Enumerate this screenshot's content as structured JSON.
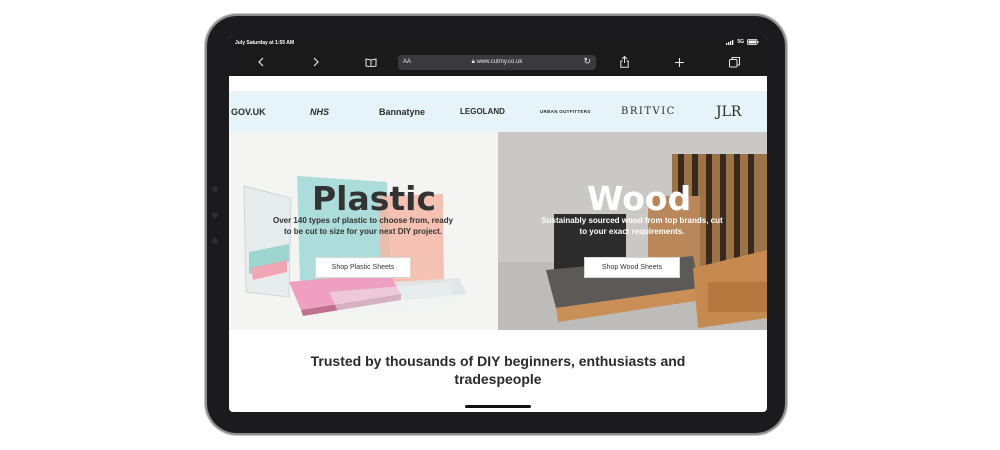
{
  "status_bar": {
    "time": "July Saturday at 1:55 AM",
    "network": "5G",
    "icons": [
      "signal-icon",
      "battery-icon"
    ]
  },
  "browser": {
    "text_size_label": "AA",
    "url": "www.cutmy.co.uk",
    "toolbar_icons": [
      "back-icon",
      "forward-icon",
      "bookmarks-icon",
      "lock-icon",
      "reload-icon",
      "share-icon",
      "new-tab-icon",
      "tabs-icon"
    ]
  },
  "logos": [
    {
      "name": "gov-uk",
      "text": "GOV.UK"
    },
    {
      "name": "nhs",
      "text": "NHS"
    },
    {
      "name": "bannatyne",
      "text": "Bannatyne"
    },
    {
      "name": "legoland",
      "text": "LEGOLAND"
    },
    {
      "name": "urban-outfitters",
      "text": "URBAN OUTFITTERS"
    },
    {
      "name": "britvic",
      "text": "BRITVIC"
    },
    {
      "name": "jlr",
      "text": "JLR"
    }
  ],
  "plastic": {
    "title": "Plastic",
    "subtitle_line1": "Over 140 types of plastic to choose from, ready",
    "subtitle_line2": "to be cut to size for your next DIY project.",
    "button": "Shop Plastic Sheets"
  },
  "wood": {
    "title": "Wood",
    "subtitle_line1": "Sustainably sourced wood from top brands, cut",
    "subtitle_line2": "to your exact requirements.",
    "button": "Shop Wood Sheets"
  },
  "trusted": {
    "line1": "Trusted by thousands of DIY beginners, enthusiasts and",
    "line2": "tradespeople"
  },
  "colors": {
    "device_frame": "#1b1b1d",
    "logo_strip": "#e6f3f9",
    "plastic_bg": "#f4f5f3",
    "wood_bg": "#c8c7c5"
  }
}
